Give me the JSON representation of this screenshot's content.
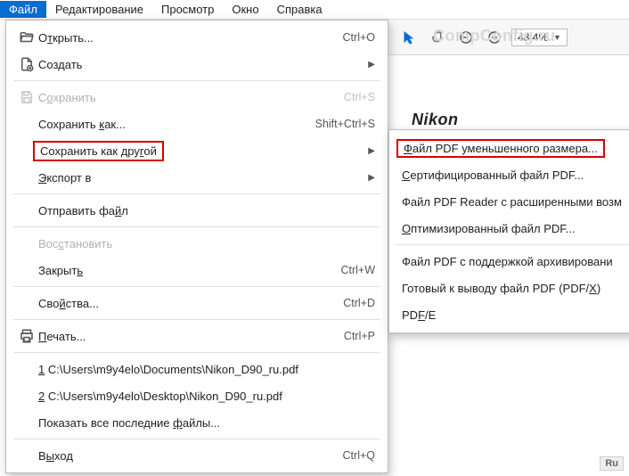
{
  "menubar": {
    "items": [
      {
        "label": "Файл",
        "active": true
      },
      {
        "label": "Редактирование"
      },
      {
        "label": "Просмотр"
      },
      {
        "label": "Окно"
      },
      {
        "label": "Справка"
      }
    ]
  },
  "watermark": "CompConfig.ru",
  "zoom": "48,4%",
  "brand": "Nikon",
  "dropdown": [
    {
      "type": "item",
      "icon": "folder-open",
      "pre": "О",
      "u": "т",
      "post": "крыть...",
      "shortcut": "Ctrl+O"
    },
    {
      "type": "item",
      "icon": "file-plus",
      "pre": "Соз",
      "u": "д",
      "post": "ать",
      "submenu": true
    },
    {
      "type": "sep"
    },
    {
      "type": "item",
      "icon": "save",
      "disabled": true,
      "pre": "С",
      "u": "о",
      "post": "хранить",
      "shortcut": "Ctrl+S"
    },
    {
      "type": "item",
      "pre": "Сохранить ",
      "u": "к",
      "post": "ак...",
      "shortcut": "Shift+Ctrl+S"
    },
    {
      "type": "item",
      "highlight": true,
      "pre": "Сохранить как дру",
      "u": "г",
      "post": "ой",
      "submenu": true
    },
    {
      "type": "item",
      "pre": "",
      "u": "Э",
      "post": "кспорт в",
      "submenu": true
    },
    {
      "type": "sep"
    },
    {
      "type": "item",
      "pre": "Отправить фа",
      "u": "й",
      "post": "л"
    },
    {
      "type": "sep"
    },
    {
      "type": "item",
      "disabled": true,
      "pre": "Вос",
      "u": "с",
      "post": "тановить"
    },
    {
      "type": "item",
      "pre": "Закрыт",
      "u": "ь",
      "post": "",
      "shortcut": "Ctrl+W"
    },
    {
      "type": "sep"
    },
    {
      "type": "item",
      "pre": "Сво",
      "u": "й",
      "post": "ства...",
      "shortcut": "Ctrl+D"
    },
    {
      "type": "sep"
    },
    {
      "type": "item",
      "icon": "printer",
      "pre": "",
      "u": "П",
      "post": "ечать...",
      "shortcut": "Ctrl+P"
    },
    {
      "type": "sep"
    },
    {
      "type": "item",
      "pre": "",
      "u": "1",
      "post": " C:\\Users\\m9y4elo\\Documents\\Nikon_D90_ru.pdf"
    },
    {
      "type": "item",
      "pre": "",
      "u": "2",
      "post": " C:\\Users\\m9y4elo\\Desktop\\Nikon_D90_ru.pdf"
    },
    {
      "type": "item",
      "pre": "Показать все последние ",
      "u": "ф",
      "post": "айлы..."
    },
    {
      "type": "sep"
    },
    {
      "type": "item",
      "pre": "В",
      "u": "ы",
      "post": "ход",
      "shortcut": "Ctrl+Q"
    }
  ],
  "submenu": [
    {
      "type": "item",
      "highlight": true,
      "pre": "",
      "u": "Ф",
      "post": "айл PDF уменьшенного размера..."
    },
    {
      "type": "item",
      "pre": "",
      "u": "С",
      "post": "ертифицированный файл PDF..."
    },
    {
      "type": "item",
      "label": "Файл PDF Reader с расширенными возм"
    },
    {
      "type": "item",
      "pre": "",
      "u": "О",
      "post": "птимизированный файл PDF..."
    },
    {
      "type": "sep"
    },
    {
      "type": "item",
      "label": "Файл PDF с поддержкой архивировани"
    },
    {
      "type": "item",
      "pre": "Готовый к выводу файл PDF (PDF/",
      "u": "X",
      "post": ")"
    },
    {
      "type": "item",
      "pre": "PD",
      "u": "F",
      "post": "/E"
    }
  ],
  "ru_badge": "Ru"
}
